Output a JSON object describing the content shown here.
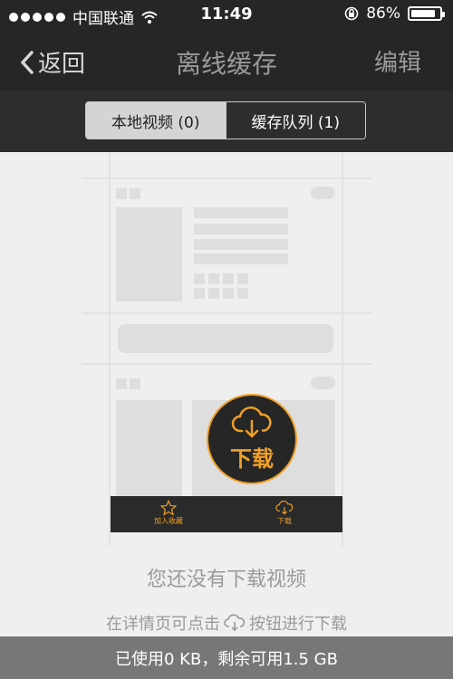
{
  "status_bar": {
    "carrier": "中国联通",
    "time": "11:49",
    "battery_percent": "86%",
    "battery_level": 0.86
  },
  "nav": {
    "back_label": "返回",
    "title": "离线缓存",
    "edit_label": "编辑"
  },
  "segments": [
    {
      "label": "本地视频 (0)",
      "selected": true
    },
    {
      "label": "缓存队列 (1)",
      "selected": false
    }
  ],
  "illustration": {
    "favorite_label": "加入收藏",
    "download_label": "下载",
    "download_button_label": "下载"
  },
  "empty_state": {
    "title": "您还没有下载视频",
    "hint_before": "在详情页可点击",
    "hint_after": "按钮进行下载"
  },
  "footer": {
    "storage_text": "已使用0 KB，剩余可用1.5 GB"
  },
  "colors": {
    "accent": "#f0a026",
    "bar": "#262626"
  }
}
